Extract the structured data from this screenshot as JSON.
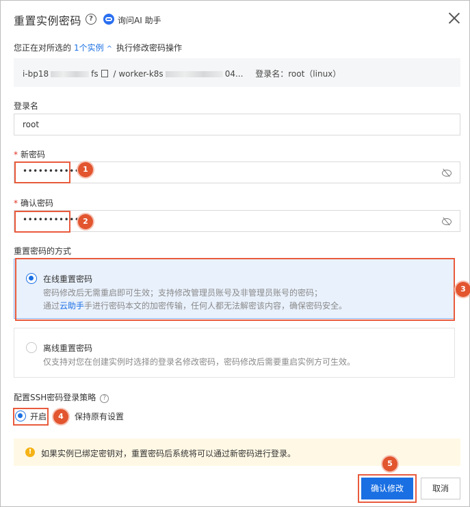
{
  "dialog": {
    "title": "重置实例密码",
    "help_symbol": "?",
    "ai_label": "询问AI 助手",
    "close_icon": "close-icon"
  },
  "intro": {
    "prefix": "您正在对所选的",
    "link": "1个实例",
    "suffix": "执行修改密码操作"
  },
  "instance": {
    "id_start": "i-bp18",
    "id_end": "fs",
    "separator": "/",
    "name_start": "worker-k8s",
    "name_end": "04...",
    "login_text": "登录名：root（linux）"
  },
  "login_name": {
    "label": "登录名",
    "value": "root"
  },
  "new_password": {
    "required_mark": "*",
    "label": "新密码",
    "masked": "•••••••••••"
  },
  "confirm_password": {
    "required_mark": "*",
    "label": "确认密码",
    "masked": "•••••••••••"
  },
  "reset_method": {
    "label": "重置密码的方式",
    "online": {
      "title": "在线重置密码",
      "desc1": "密码修改后无需重启即可生效；支持修改管理员账号及非管理员账号的密码；",
      "desc2_prefix": "通过",
      "desc2_link": "云助手",
      "desc2_suffix": "手进行密码本文的加密传输，任何人都无法解密该内容，确保密码安全。",
      "selected": true
    },
    "offline": {
      "title": "离线重置密码",
      "desc": "仅支持对您在创建实例时选择的登录名修改密码，密码修改后需要重启实例方可生效。",
      "selected": false
    }
  },
  "ssh": {
    "label": "配置SSH密码登录策略",
    "help_symbol": "?",
    "enable": "开启",
    "keep": "保持原有设置",
    "selected": "开启"
  },
  "notice": {
    "icon_symbol": "!",
    "text": "如果实例已绑定密钥对，重置密码后系统将可以通过新密码进行登录。"
  },
  "actions": {
    "confirm": "确认修改",
    "cancel": "取消"
  },
  "steps": [
    "1",
    "2",
    "3",
    "4",
    "5"
  ],
  "colors": {
    "accent": "#1a6fe3",
    "highlight": "#e85a3c",
    "warning": "#f5b316"
  }
}
